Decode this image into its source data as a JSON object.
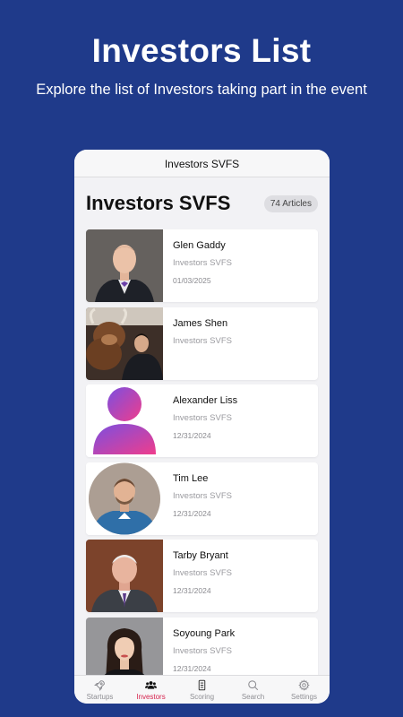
{
  "promo": {
    "title": "Investors List",
    "subtitle": "Explore the list of Investors taking part in the event"
  },
  "nav": {
    "title": "Investors SVFS"
  },
  "header": {
    "title": "Investors SVFS",
    "count": "74 Articles"
  },
  "items": [
    {
      "name": "Glen Gaddy",
      "org": "Investors SVFS",
      "date": "01/03/2025"
    },
    {
      "name": "James Shen",
      "org": "Investors SVFS",
      "date": ""
    },
    {
      "name": "Alexander Liss",
      "org": "Investors SVFS",
      "date": "12/31/2024"
    },
    {
      "name": "Tim Lee",
      "org": "Investors SVFS",
      "date": "12/31/2024"
    },
    {
      "name": "Tarby Bryant",
      "org": "Investors SVFS",
      "date": "12/31/2024"
    },
    {
      "name": "Soyoung Park",
      "org": "Investors SVFS",
      "date": "12/31/2024"
    }
  ],
  "tabs": [
    {
      "label": "Startups",
      "icon": "rocket-icon"
    },
    {
      "label": "Investors",
      "icon": "users-icon"
    },
    {
      "label": "Scoring",
      "icon": "list-icon"
    },
    {
      "label": "Search",
      "icon": "search-icon"
    },
    {
      "label": "Settings",
      "icon": "gear-icon"
    }
  ],
  "colors": {
    "background": "#1f3a8a",
    "active_tab": "#d6244f",
    "placeholder_gradient_start": "#7b4fe0",
    "placeholder_gradient_end": "#ef3d8c"
  }
}
